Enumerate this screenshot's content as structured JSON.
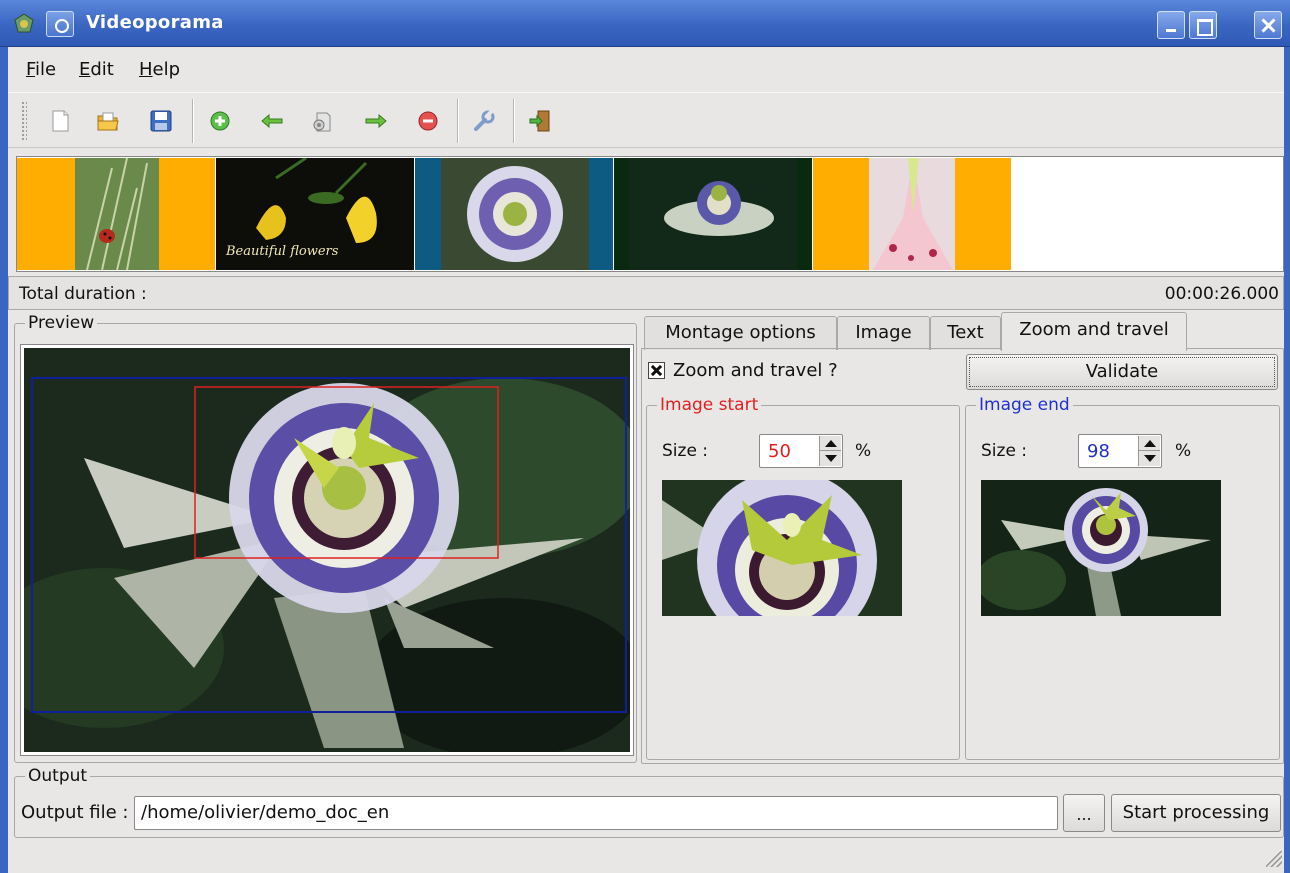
{
  "window": {
    "title": "Videoporama"
  },
  "menu": {
    "file": "File",
    "edit": "Edit",
    "help": "Help"
  },
  "toolbar": {
    "icons": [
      "new-document-icon",
      "open-folder-icon",
      "save-icon",
      "add-image-icon",
      "move-left-icon",
      "properties-icon",
      "move-right-icon",
      "remove-image-icon",
      "settings-wrench-icon",
      "exit-icon"
    ]
  },
  "strip": {
    "thumbnails": [
      "ladybug on grass",
      "Beautiful flowers",
      "passion flower",
      "passion flower dark",
      "lily"
    ],
    "title_card_text": "Beautiful flowers"
  },
  "duration": {
    "label": "Total duration :",
    "value": "00:00:26.000"
  },
  "preview": {
    "legend": "Preview"
  },
  "tabs": [
    "Montage options",
    "Image",
    "Text",
    "Zoom and travel"
  ],
  "active_tab": "Zoom and travel",
  "zoom": {
    "checkbox_label": "Zoom and travel ?",
    "checked": true,
    "validate_label": "Validate",
    "start": {
      "legend": "Image start",
      "size_label": "Size :",
      "size_value": "50",
      "unit": "%",
      "color": "#e02020"
    },
    "end": {
      "legend": "Image end",
      "size_label": "Size :",
      "size_value": "98",
      "unit": "%",
      "color": "#2030d0"
    }
  },
  "output": {
    "legend": "Output",
    "file_label": "Output file :",
    "file_value": "/home/olivier/demo_doc_en",
    "browse_label": "...",
    "start_label": "Start processing"
  },
  "colors": {
    "titlebar": "#3a66c2",
    "start_frame": "#e02020",
    "end_frame": "#10209a",
    "strip_orange": "#ffad00",
    "strip_blue": "#0d5a82"
  }
}
